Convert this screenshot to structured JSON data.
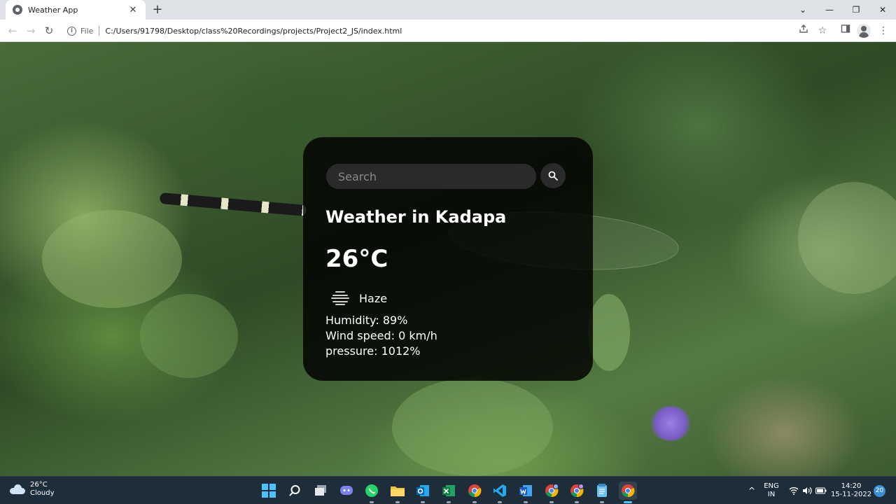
{
  "browser": {
    "tab_title": "Weather App",
    "tab_close": "✕",
    "new_tab": "+",
    "window_controls": [
      "⌄",
      "—",
      "❐",
      "✕"
    ],
    "nav": {
      "back": "←",
      "forward": "→",
      "reload": "↻"
    },
    "address": {
      "scheme_label": "File",
      "url": "C:/Users/91798/Desktop/class%20Recordings/projects/Project2_JS/index.html"
    }
  },
  "weather_card": {
    "search_placeholder": "Search",
    "heading": "Weather in Kadapa",
    "temperature": "26°C",
    "condition": "Haze",
    "humidity": "Humidity: 89%",
    "wind": "Wind speed: 0 km/h",
    "pressure": "pressure: 1012%"
  },
  "taskbar": {
    "weather_temp": "26°C",
    "weather_desc": "Cloudy",
    "apps": [
      "Start",
      "Search",
      "Task View",
      "Chat",
      "WhatsApp",
      "File Explorer",
      "Outlook",
      "Excel",
      "Chrome",
      "Visual Studio Code",
      "Word",
      "Chrome",
      "Chrome",
      "Notepad",
      "Chrome"
    ],
    "language_line1": "ENG",
    "language_line2": "IN",
    "time": "14:20",
    "date": "15-11-2022",
    "notification_count": "20"
  }
}
